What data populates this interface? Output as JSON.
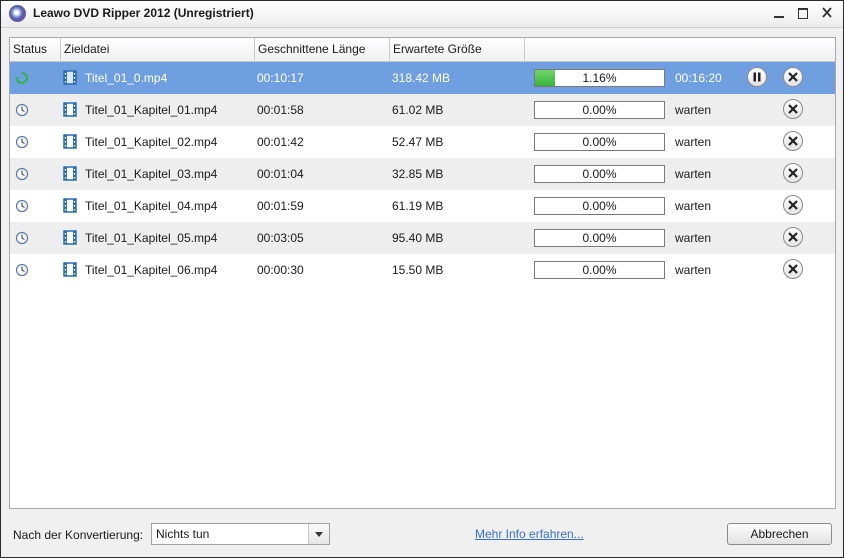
{
  "window": {
    "title": "Leawo DVD Ripper 2012 (Unregistriert)",
    "minimize_icon": "minimize-icon",
    "maximize_icon": "maximize-icon",
    "close_icon": "close-icon"
  },
  "table": {
    "columns": [
      "Status",
      "Zieldatei",
      "Geschnittene Länge",
      "Erwartete Größe",
      ""
    ],
    "rows": [
      {
        "status": "converting",
        "file": "Titel_01_0.mp4",
        "length": "00:10:17",
        "size": "318.42 MB",
        "progress": 0.0116,
        "progress_text": "1.16%",
        "state": "00:16:20",
        "selected": true,
        "pausable": true
      },
      {
        "status": "waiting",
        "file": "Titel_01_Kapitel_01.mp4",
        "length": "00:01:58",
        "size": "61.02 MB",
        "progress": 0,
        "progress_text": "0.00%",
        "state": "warten",
        "selected": false,
        "pausable": false
      },
      {
        "status": "waiting",
        "file": "Titel_01_Kapitel_02.mp4",
        "length": "00:01:42",
        "size": "52.47 MB",
        "progress": 0,
        "progress_text": "0.00%",
        "state": "warten",
        "selected": false,
        "pausable": false
      },
      {
        "status": "waiting",
        "file": "Titel_01_Kapitel_03.mp4",
        "length": "00:01:04",
        "size": "32.85 MB",
        "progress": 0,
        "progress_text": "0.00%",
        "state": "warten",
        "selected": false,
        "pausable": false
      },
      {
        "status": "waiting",
        "file": "Titel_01_Kapitel_04.mp4",
        "length": "00:01:59",
        "size": "61.19 MB",
        "progress": 0,
        "progress_text": "0.00%",
        "state": "warten",
        "selected": false,
        "pausable": false
      },
      {
        "status": "waiting",
        "file": "Titel_01_Kapitel_05.mp4",
        "length": "00:03:05",
        "size": "95.40 MB",
        "progress": 0,
        "progress_text": "0.00%",
        "state": "warten",
        "selected": false,
        "pausable": false
      },
      {
        "status": "waiting",
        "file": "Titel_01_Kapitel_06.mp4",
        "length": "00:00:30",
        "size": "15.50 MB",
        "progress": 0,
        "progress_text": "0.00%",
        "state": "warten",
        "selected": false,
        "pausable": false
      }
    ]
  },
  "footer": {
    "after_label": "Nach der Konvertierung:",
    "after_value": "Nichts tun",
    "info_link": "Mehr Info erfahren...",
    "cancel_label": "Abbrechen"
  },
  "colors": {
    "selected_row": "#6f9fe0",
    "progress_fill": "#39b437",
    "link": "#3a6fd0"
  }
}
